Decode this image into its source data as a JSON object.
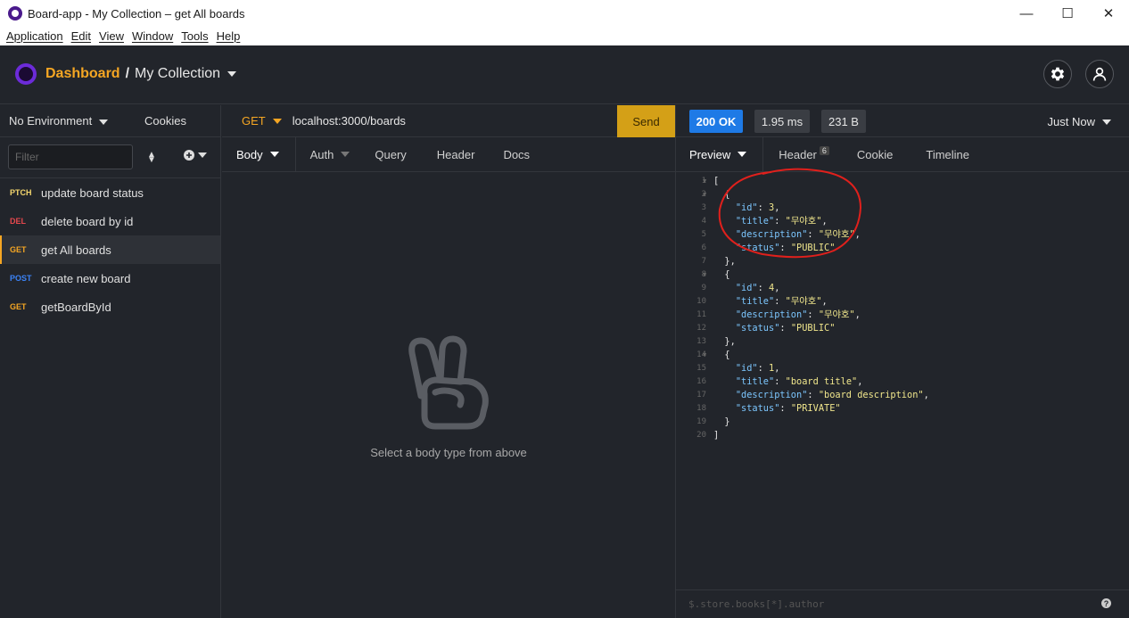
{
  "window": {
    "title": "Board-app - My Collection – get All boards",
    "controls": {
      "minimize": "—",
      "maximize": "☐",
      "close": "✕"
    }
  },
  "menu": [
    "Application",
    "Edit",
    "View",
    "Window",
    "Tools",
    "Help"
  ],
  "header": {
    "dashboard": "Dashboard",
    "separator": "/",
    "collection": "My Collection"
  },
  "sidebar": {
    "environment": "No Environment",
    "cookies": "Cookies",
    "filter_placeholder": "Filter",
    "requests": [
      {
        "method": "PTCH",
        "color": "#f5d76e",
        "label": "update board status",
        "active": false
      },
      {
        "method": "DEL",
        "color": "#e5484d",
        "label": "delete board by id",
        "active": false
      },
      {
        "method": "GET",
        "color": "#f5a623",
        "label": "get All boards",
        "active": true
      },
      {
        "method": "POST",
        "color": "#3b82f6",
        "label": "create new board",
        "active": false
      },
      {
        "method": "GET",
        "color": "#f5a623",
        "label": "getBoardById",
        "active": false
      }
    ]
  },
  "request": {
    "method": "GET",
    "url": "localhost:3000/boards",
    "send": "Send",
    "tabs": [
      "Body",
      "Auth",
      "Query",
      "Header",
      "Docs"
    ],
    "empty_hint": "Select a body type from above"
  },
  "response": {
    "status": "200 OK",
    "time": "1.95 ms",
    "size": "231 B",
    "when": "Just Now",
    "tabs": [
      "Preview",
      "Header",
      "Cookie",
      "Timeline"
    ],
    "header_count": "6",
    "filter_placeholder": "$.store.books[*].author",
    "help": "?",
    "lines": [
      "[",
      "  {",
      "    \"id\": 3,",
      "    \"title\": \"무야호\",",
      "    \"description\": \"무야호\",",
      "    \"status\": \"PUBLIC\"",
      "  },",
      "  {",
      "    \"id\": 4,",
      "    \"title\": \"무야호\",",
      "    \"description\": \"무야호\",",
      "    \"status\": \"PUBLIC\"",
      "  },",
      "  {",
      "    \"id\": 1,",
      "    \"title\": \"board title\",",
      "    \"description\": \"board description\",",
      "    \"status\": \"PRIVATE\"",
      "  }",
      "]"
    ]
  }
}
